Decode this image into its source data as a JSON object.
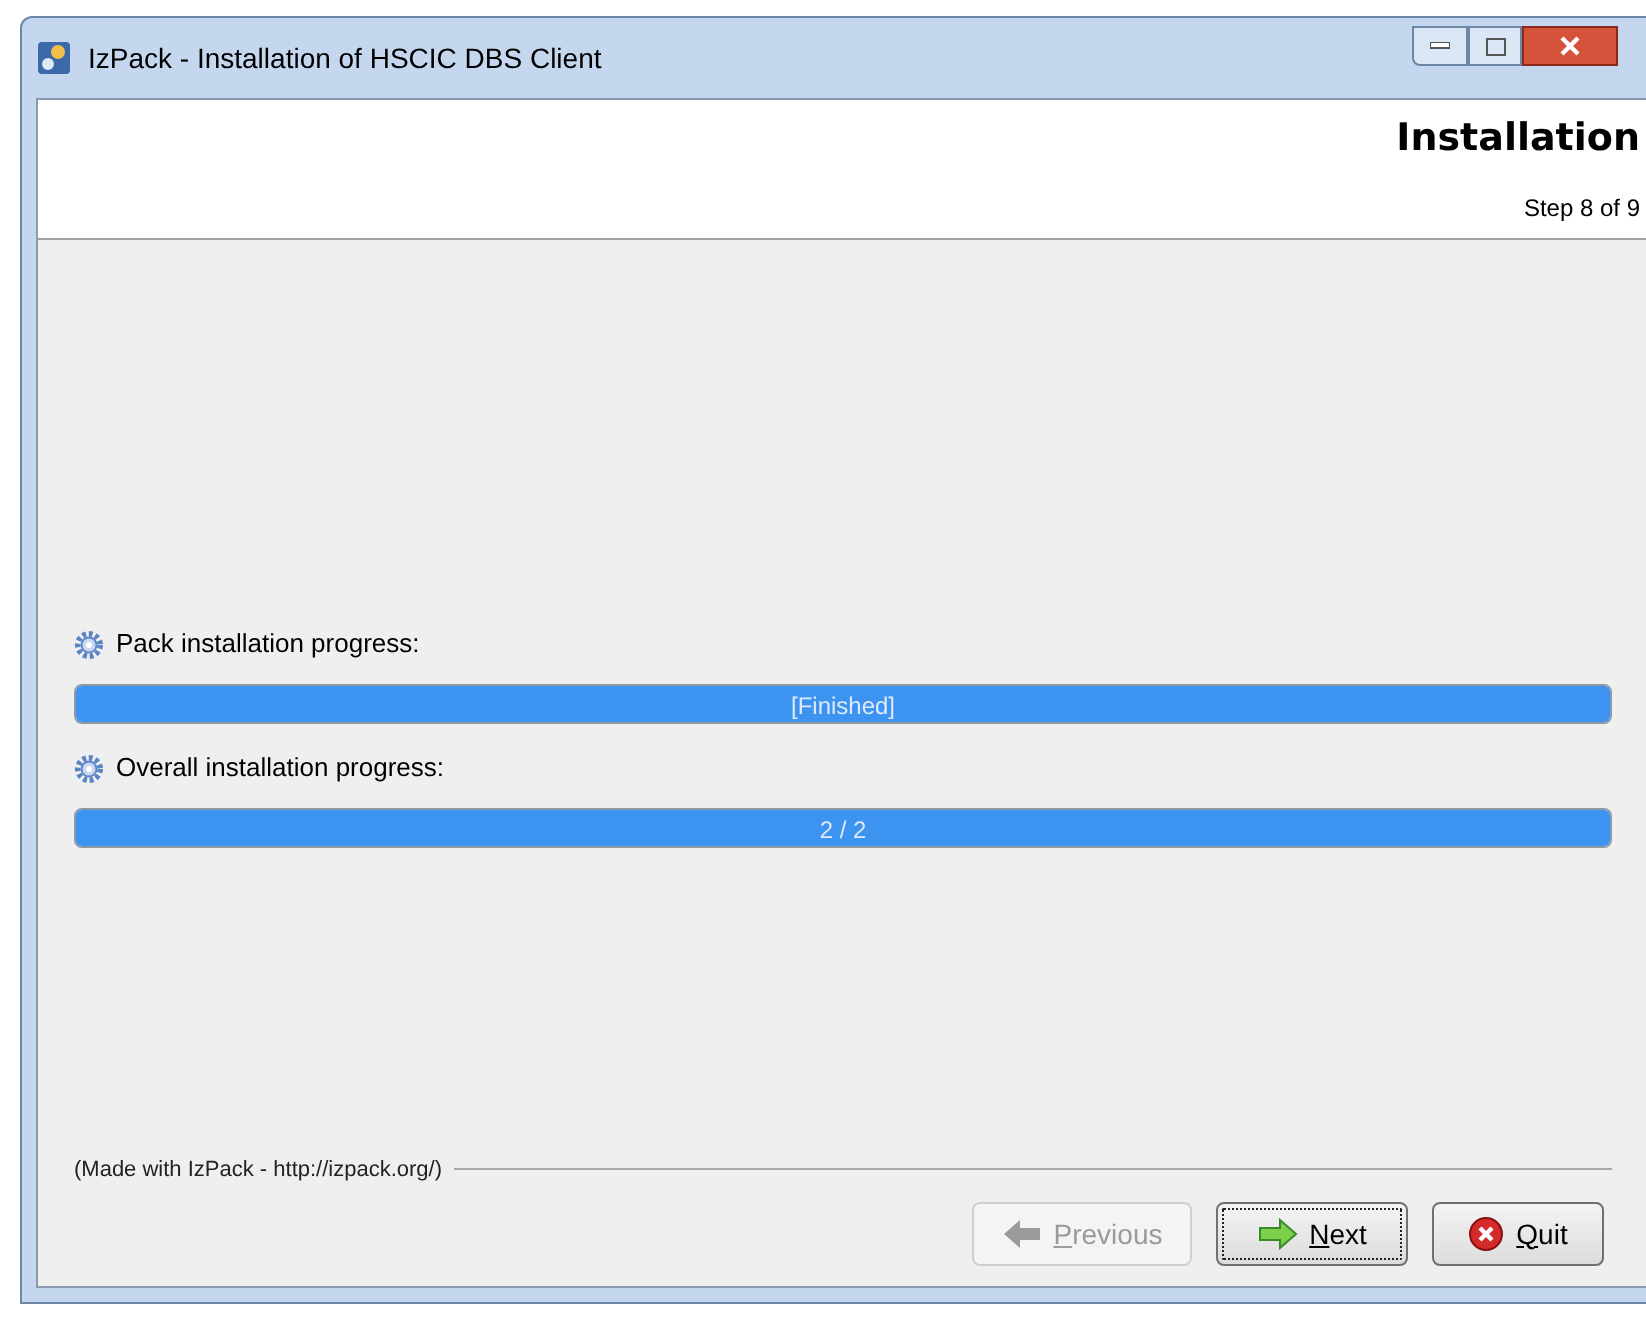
{
  "window": {
    "title": "IzPack - Installation of HSCIC DBS Client"
  },
  "header": {
    "title": "Installation",
    "step": "Step 8 of 9"
  },
  "progress": [
    {
      "label": "Pack installation progress:",
      "reading": "[Finished]",
      "level": 1
    },
    {
      "label": "Overall installation progress:",
      "reading": "2 / 2",
      "level": 1
    }
  ],
  "footer": {
    "credit": "(Made with IzPack - http://izpack.org/)"
  },
  "buttons": [
    {
      "label": "Previous",
      "kind": "previous",
      "disabled": true,
      "focused": false
    },
    {
      "label": "Next",
      "kind": "next",
      "disabled": false,
      "focused": true
    },
    {
      "label": "Quit",
      "kind": "quit",
      "disabled": false,
      "focused": false
    }
  ]
}
